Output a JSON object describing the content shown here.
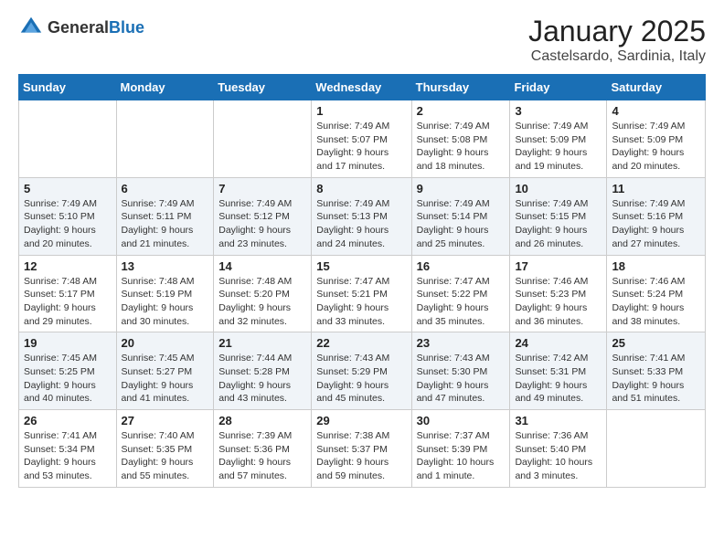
{
  "header": {
    "logo_general": "General",
    "logo_blue": "Blue",
    "month": "January 2025",
    "location": "Castelsardo, Sardinia, Italy"
  },
  "days_of_week": [
    "Sunday",
    "Monday",
    "Tuesday",
    "Wednesday",
    "Thursday",
    "Friday",
    "Saturday"
  ],
  "weeks": [
    [
      {
        "day": "",
        "info": ""
      },
      {
        "day": "",
        "info": ""
      },
      {
        "day": "",
        "info": ""
      },
      {
        "day": "1",
        "sunrise": "Sunrise: 7:49 AM",
        "sunset": "Sunset: 5:07 PM",
        "daylight": "Daylight: 9 hours and 17 minutes."
      },
      {
        "day": "2",
        "sunrise": "Sunrise: 7:49 AM",
        "sunset": "Sunset: 5:08 PM",
        "daylight": "Daylight: 9 hours and 18 minutes."
      },
      {
        "day": "3",
        "sunrise": "Sunrise: 7:49 AM",
        "sunset": "Sunset: 5:09 PM",
        "daylight": "Daylight: 9 hours and 19 minutes."
      },
      {
        "day": "4",
        "sunrise": "Sunrise: 7:49 AM",
        "sunset": "Sunset: 5:09 PM",
        "daylight": "Daylight: 9 hours and 20 minutes."
      }
    ],
    [
      {
        "day": "5",
        "sunrise": "Sunrise: 7:49 AM",
        "sunset": "Sunset: 5:10 PM",
        "daylight": "Daylight: 9 hours and 20 minutes."
      },
      {
        "day": "6",
        "sunrise": "Sunrise: 7:49 AM",
        "sunset": "Sunset: 5:11 PM",
        "daylight": "Daylight: 9 hours and 21 minutes."
      },
      {
        "day": "7",
        "sunrise": "Sunrise: 7:49 AM",
        "sunset": "Sunset: 5:12 PM",
        "daylight": "Daylight: 9 hours and 23 minutes."
      },
      {
        "day": "8",
        "sunrise": "Sunrise: 7:49 AM",
        "sunset": "Sunset: 5:13 PM",
        "daylight": "Daylight: 9 hours and 24 minutes."
      },
      {
        "day": "9",
        "sunrise": "Sunrise: 7:49 AM",
        "sunset": "Sunset: 5:14 PM",
        "daylight": "Daylight: 9 hours and 25 minutes."
      },
      {
        "day": "10",
        "sunrise": "Sunrise: 7:49 AM",
        "sunset": "Sunset: 5:15 PM",
        "daylight": "Daylight: 9 hours and 26 minutes."
      },
      {
        "day": "11",
        "sunrise": "Sunrise: 7:49 AM",
        "sunset": "Sunset: 5:16 PM",
        "daylight": "Daylight: 9 hours and 27 minutes."
      }
    ],
    [
      {
        "day": "12",
        "sunrise": "Sunrise: 7:48 AM",
        "sunset": "Sunset: 5:17 PM",
        "daylight": "Daylight: 9 hours and 29 minutes."
      },
      {
        "day": "13",
        "sunrise": "Sunrise: 7:48 AM",
        "sunset": "Sunset: 5:19 PM",
        "daylight": "Daylight: 9 hours and 30 minutes."
      },
      {
        "day": "14",
        "sunrise": "Sunrise: 7:48 AM",
        "sunset": "Sunset: 5:20 PM",
        "daylight": "Daylight: 9 hours and 32 minutes."
      },
      {
        "day": "15",
        "sunrise": "Sunrise: 7:47 AM",
        "sunset": "Sunset: 5:21 PM",
        "daylight": "Daylight: 9 hours and 33 minutes."
      },
      {
        "day": "16",
        "sunrise": "Sunrise: 7:47 AM",
        "sunset": "Sunset: 5:22 PM",
        "daylight": "Daylight: 9 hours and 35 minutes."
      },
      {
        "day": "17",
        "sunrise": "Sunrise: 7:46 AM",
        "sunset": "Sunset: 5:23 PM",
        "daylight": "Daylight: 9 hours and 36 minutes."
      },
      {
        "day": "18",
        "sunrise": "Sunrise: 7:46 AM",
        "sunset": "Sunset: 5:24 PM",
        "daylight": "Daylight: 9 hours and 38 minutes."
      }
    ],
    [
      {
        "day": "19",
        "sunrise": "Sunrise: 7:45 AM",
        "sunset": "Sunset: 5:25 PM",
        "daylight": "Daylight: 9 hours and 40 minutes."
      },
      {
        "day": "20",
        "sunrise": "Sunrise: 7:45 AM",
        "sunset": "Sunset: 5:27 PM",
        "daylight": "Daylight: 9 hours and 41 minutes."
      },
      {
        "day": "21",
        "sunrise": "Sunrise: 7:44 AM",
        "sunset": "Sunset: 5:28 PM",
        "daylight": "Daylight: 9 hours and 43 minutes."
      },
      {
        "day": "22",
        "sunrise": "Sunrise: 7:43 AM",
        "sunset": "Sunset: 5:29 PM",
        "daylight": "Daylight: 9 hours and 45 minutes."
      },
      {
        "day": "23",
        "sunrise": "Sunrise: 7:43 AM",
        "sunset": "Sunset: 5:30 PM",
        "daylight": "Daylight: 9 hours and 47 minutes."
      },
      {
        "day": "24",
        "sunrise": "Sunrise: 7:42 AM",
        "sunset": "Sunset: 5:31 PM",
        "daylight": "Daylight: 9 hours and 49 minutes."
      },
      {
        "day": "25",
        "sunrise": "Sunrise: 7:41 AM",
        "sunset": "Sunset: 5:33 PM",
        "daylight": "Daylight: 9 hours and 51 minutes."
      }
    ],
    [
      {
        "day": "26",
        "sunrise": "Sunrise: 7:41 AM",
        "sunset": "Sunset: 5:34 PM",
        "daylight": "Daylight: 9 hours and 53 minutes."
      },
      {
        "day": "27",
        "sunrise": "Sunrise: 7:40 AM",
        "sunset": "Sunset: 5:35 PM",
        "daylight": "Daylight: 9 hours and 55 minutes."
      },
      {
        "day": "28",
        "sunrise": "Sunrise: 7:39 AM",
        "sunset": "Sunset: 5:36 PM",
        "daylight": "Daylight: 9 hours and 57 minutes."
      },
      {
        "day": "29",
        "sunrise": "Sunrise: 7:38 AM",
        "sunset": "Sunset: 5:37 PM",
        "daylight": "Daylight: 9 hours and 59 minutes."
      },
      {
        "day": "30",
        "sunrise": "Sunrise: 7:37 AM",
        "sunset": "Sunset: 5:39 PM",
        "daylight": "Daylight: 10 hours and 1 minute."
      },
      {
        "day": "31",
        "sunrise": "Sunrise: 7:36 AM",
        "sunset": "Sunset: 5:40 PM",
        "daylight": "Daylight: 10 hours and 3 minutes."
      },
      {
        "day": "",
        "info": ""
      }
    ]
  ]
}
